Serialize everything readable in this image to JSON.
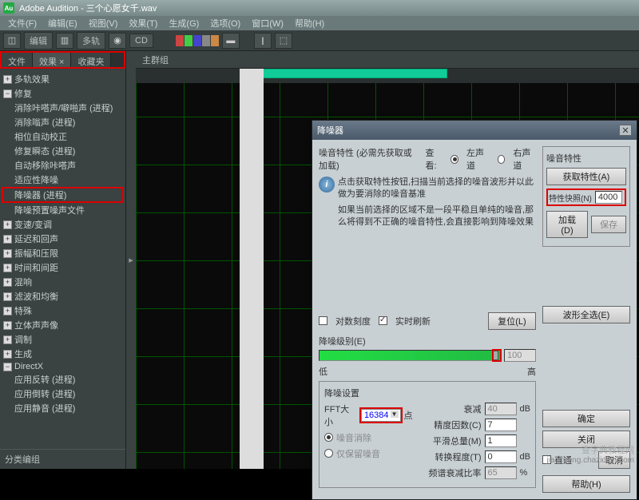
{
  "title": "Adobe Audition - 三个心愿女千.wav",
  "menu": [
    "文件(F)",
    "编辑(E)",
    "视图(V)",
    "效果(T)",
    "生成(G)",
    "选项(O)",
    "窗口(W)",
    "帮助(H)"
  ],
  "toolbar": {
    "edit": "编辑",
    "multi": "多轨",
    "cd": "CD"
  },
  "tabs": {
    "file": "文件",
    "effects": "效果 ×",
    "fav": "收藏夹"
  },
  "tree": {
    "multitrack_fx": "多轨效果",
    "repair": "修复",
    "r1": "消除咔嗒声/噼啪声 (进程)",
    "r2": "消除嗡声 (进程)",
    "r3": "相位自动校正",
    "r4": "修复瞬态 (进程)",
    "r5": "自动移除咔嗒声",
    "r6": "适应性降噪",
    "r7": "降噪器 (进程)",
    "r8": "降噪预置噪声文件",
    "cat1": "变速/变调",
    "cat2": "延迟和回声",
    "cat3": "振幅和压限",
    "cat4": "时间和间距",
    "cat5": "混响",
    "cat6": "滤波和均衡",
    "cat7": "特殊",
    "cat8": "立体声声像",
    "cat9": "调制",
    "cat10": "生成",
    "cat11": "DirectX",
    "sub1": "应用反转 (进程)",
    "sub2": "应用倒转 (进程)",
    "sub3": "应用静音 (进程)",
    "footer": "分类编组"
  },
  "group_tab": "主群组",
  "dialog": {
    "title": "降噪器",
    "section1_label": "噪音特性 (必需先获取或加载)",
    "view_label": "查看:",
    "radio_left": "左声道",
    "radio_right": "右声道",
    "info1": "点击获取特性按钮,扫描当前选择的噪音波形并以此做为要消除的噪音基准",
    "info2": "如果当前选择的区域不是一段平稳且单纯的噪音,那么将得到不正确的噪音特性,会直接影响到降噪效果",
    "noise_props": "噪音特性",
    "btn_get": "获取特性(A)",
    "snapshot_label": "特性快照(N)",
    "snapshot_val": "4000",
    "btn_load": "加载(D)",
    "btn_save": "保存",
    "cb_log": "对数刻度",
    "cb_live": "实时刷新",
    "btn_reset": "复位(L)",
    "level_label": "降噪级别(E)",
    "level_low": "低",
    "level_high": "高",
    "level_val": "100",
    "btn_selectall": "波形全选(E)",
    "settings": "降噪设置",
    "fft_label": "FFT大小",
    "fft_val": "16384",
    "fft_unit": "点",
    "radio_remove": "噪音消除",
    "radio_keep": "仅保留噪音",
    "atten_label": "衰减",
    "atten_val": "40",
    "atten_unit": "dB",
    "precision_label": "精度因数(C)",
    "precision_val": "7",
    "smooth_label": "平滑总量(M)",
    "smooth_val": "1",
    "trans_label": "转换程度(T)",
    "trans_val": "0",
    "trans_unit": "dB",
    "freq_label": "频谱衰减比率",
    "freq_val": "65",
    "freq_unit": "%",
    "cb_direct": "直通",
    "btn_ok": "确定",
    "btn_close": "关闭",
    "btn_cancel": "取消",
    "btn_help": "帮助(H)"
  },
  "watermark": {
    "main": "查字典教程网",
    "sub": "jiaocheng.chazidian.com"
  }
}
